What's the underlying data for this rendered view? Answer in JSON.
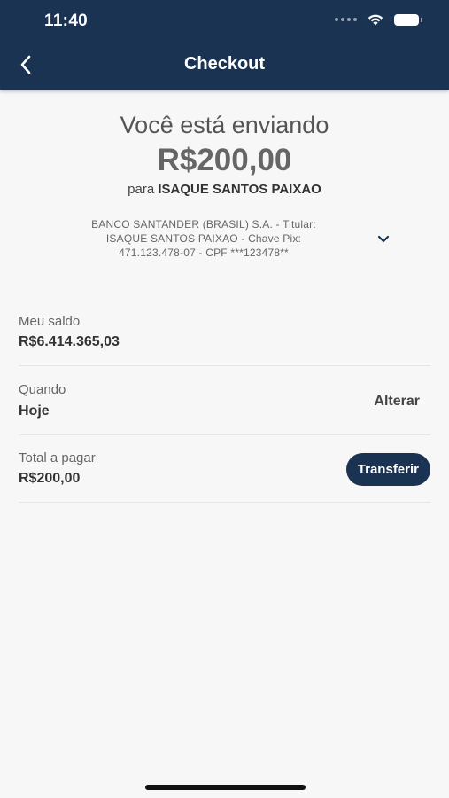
{
  "status_bar": {
    "time": "11:40"
  },
  "header": {
    "title": "Checkout"
  },
  "summary": {
    "sending_label": "Você está enviando",
    "amount": "R$200,00",
    "recipient_prefix": "para",
    "recipient_name": "ISAQUE SANTOS PAIXAO"
  },
  "bank_details": {
    "line1": "BANCO SANTANDER (BRASIL) S.A. - Titular:",
    "line2": "ISAQUE SANTOS PAIXAO - Chave Pix:",
    "line3": "471.123.478-07 - CPF ***123478**"
  },
  "balance": {
    "label": "Meu saldo",
    "value": "R$6.414.365,03"
  },
  "schedule": {
    "label": "Quando",
    "value": "Hoje",
    "action_label": "Alterar"
  },
  "total": {
    "label": "Total a pagar",
    "value": "R$200,00",
    "action_label": "Transferir"
  },
  "colors": {
    "header_bg": "#1b3353",
    "button_bg": "#1b3353",
    "background": "#f7f7f7"
  }
}
